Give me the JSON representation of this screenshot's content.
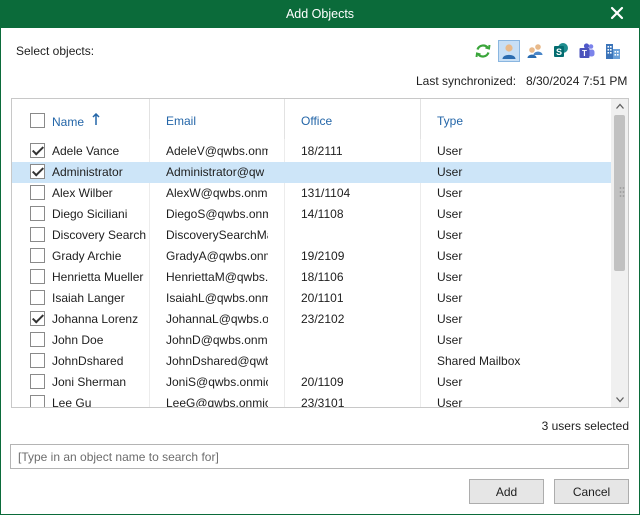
{
  "window": {
    "title": "Add Objects"
  },
  "select_label": "Select objects:",
  "toolbar": {
    "buttons": [
      {
        "icon": "refresh-icon",
        "active": false
      },
      {
        "icon": "user-icon",
        "active": true
      },
      {
        "icon": "group-icon",
        "active": false
      },
      {
        "icon": "sharepoint-icon",
        "active": false
      },
      {
        "icon": "teams-icon",
        "active": false
      },
      {
        "icon": "organization-icon",
        "active": false
      }
    ]
  },
  "sync": {
    "label": "Last synchronized:",
    "value": "8/30/2024 7:51 PM"
  },
  "grid": {
    "columns": [
      "Name",
      "Email",
      "Office",
      "Type"
    ],
    "rows": [
      {
        "checked": true,
        "selected": false,
        "name": "Adele Vance",
        "email": "AdeleV@qwbs.onmi",
        "office": "18/2111",
        "type": "User"
      },
      {
        "checked": true,
        "selected": true,
        "name": "Administrator",
        "email": "Administrator@qw",
        "office": "",
        "type": "User"
      },
      {
        "checked": false,
        "selected": false,
        "name": "Alex Wilber",
        "email": "AlexW@qwbs.onm",
        "office": "131/1104",
        "type": "User"
      },
      {
        "checked": false,
        "selected": false,
        "name": "Diego Siciliani",
        "email": "DiegoS@qwbs.onm",
        "office": "14/1108",
        "type": "User"
      },
      {
        "checked": false,
        "selected": false,
        "name": "Discovery Search",
        "email": "DiscoverySearchMa",
        "office": "",
        "type": "User"
      },
      {
        "checked": false,
        "selected": false,
        "name": "Grady Archie",
        "email": "GradyA@qwbs.onm",
        "office": "19/2109",
        "type": "User"
      },
      {
        "checked": false,
        "selected": false,
        "name": "Henrietta Mueller",
        "email": "HenriettaM@qwbs.",
        "office": "18/1106",
        "type": "User"
      },
      {
        "checked": false,
        "selected": false,
        "name": "Isaiah Langer",
        "email": "IsaiahL@qwbs.onm",
        "office": "20/1101",
        "type": "User"
      },
      {
        "checked": true,
        "selected": false,
        "name": "Johanna Lorenz",
        "email": "JohannaL@qwbs.o",
        "office": "23/2102",
        "type": "User"
      },
      {
        "checked": false,
        "selected": false,
        "name": "John Doe",
        "email": "JohnD@qwbs.onm",
        "office": "",
        "type": "User"
      },
      {
        "checked": false,
        "selected": false,
        "name": "JohnDshared",
        "email": "JohnDshared@qwb",
        "office": "",
        "type": "Shared Mailbox"
      },
      {
        "checked": false,
        "selected": false,
        "name": "Joni Sherman",
        "email": "JoniS@qwbs.onmic",
        "office": "20/1109",
        "type": "User"
      },
      {
        "checked": false,
        "selected": false,
        "name": "Lee Gu",
        "email": "LeeG@qwbs.onmic",
        "office": "23/3101",
        "type": "User"
      }
    ]
  },
  "selection_count": "3 users selected",
  "search": {
    "placeholder": "[Type in an object name to search for]",
    "value": ""
  },
  "buttons": {
    "add": "Add",
    "cancel": "Cancel"
  }
}
